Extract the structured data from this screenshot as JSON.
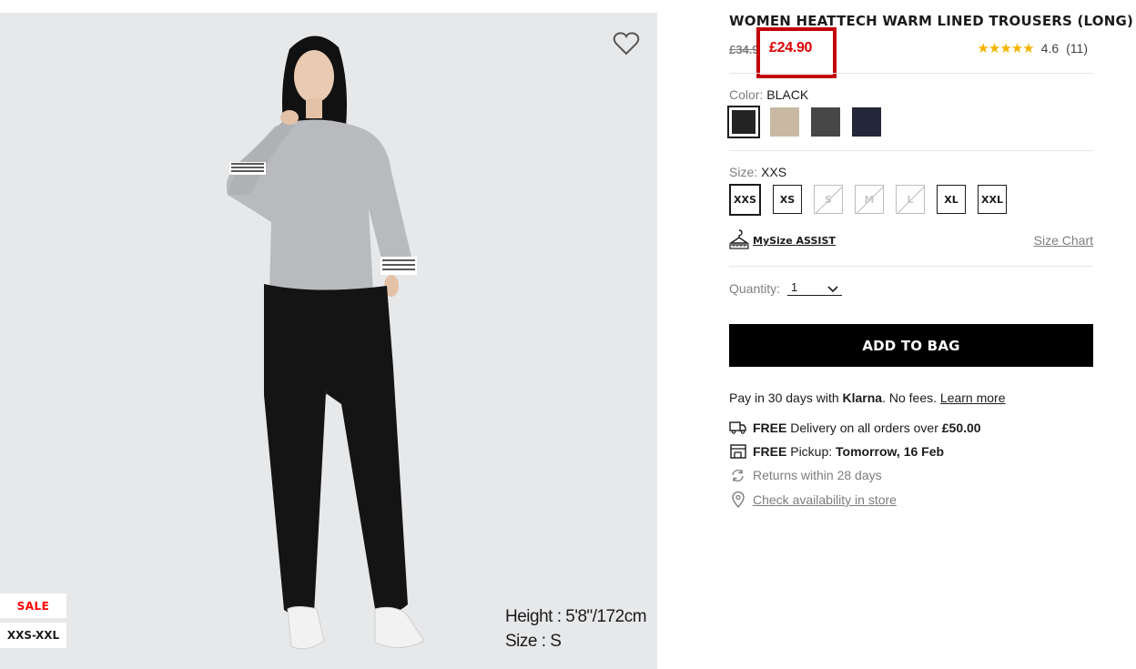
{
  "product": {
    "title": "WOMEN HEATTECH WARM LINED TROUSERS (LONG)",
    "original_price": "£34.9",
    "sale_price": "£24.90",
    "rating": {
      "stars": "★★★★★",
      "value": "4.6",
      "count": "(11)"
    }
  },
  "photo": {
    "sale_tag": "SALE",
    "size_range_tag": "XXS-XXL",
    "model_height": "Height : 5'8\"/172cm",
    "model_size": "Size : S"
  },
  "color": {
    "label": "Color:",
    "selected": "BLACK",
    "options": [
      {
        "name": "black",
        "hex": "#242424"
      },
      {
        "name": "beige",
        "hex": "#c9b9a3"
      },
      {
        "name": "dark-gray",
        "hex": "#474747"
      },
      {
        "name": "navy",
        "hex": "#24273a"
      }
    ]
  },
  "size": {
    "label": "Size:",
    "selected": "XXS",
    "options": [
      {
        "label": "XXS",
        "available": true
      },
      {
        "label": "XS",
        "available": true
      },
      {
        "label": "S",
        "available": false
      },
      {
        "label": "M",
        "available": false
      },
      {
        "label": "L",
        "available": false
      },
      {
        "label": "XL",
        "available": true
      },
      {
        "label": "XXL",
        "available": true
      }
    ],
    "mysize_label": "MySize  ASSIST",
    "size_chart_label": "Size Chart"
  },
  "quantity": {
    "label": "Quantity:",
    "value": "1"
  },
  "add_to_bag_label": "ADD TO BAG",
  "klarna": {
    "prefix": "Pay in 30 days with ",
    "brand": "Klarna",
    "suffix": ". No fees. ",
    "link": "Learn more"
  },
  "perks": {
    "delivery_bold": "FREE",
    "delivery_text": " Delivery on all orders over ",
    "delivery_amount": "£50.00",
    "pickup_bold": "FREE",
    "pickup_text": " Pickup: ",
    "pickup_when": "Tomorrow, 16 Feb",
    "returns_text": "Returns within 28 days",
    "store_link": "Check availability in store"
  },
  "colors": {
    "sale_red": "#ff0000",
    "price_red": "#e00000",
    "highlight_box": "#c3000a",
    "star": "#f4b400"
  }
}
